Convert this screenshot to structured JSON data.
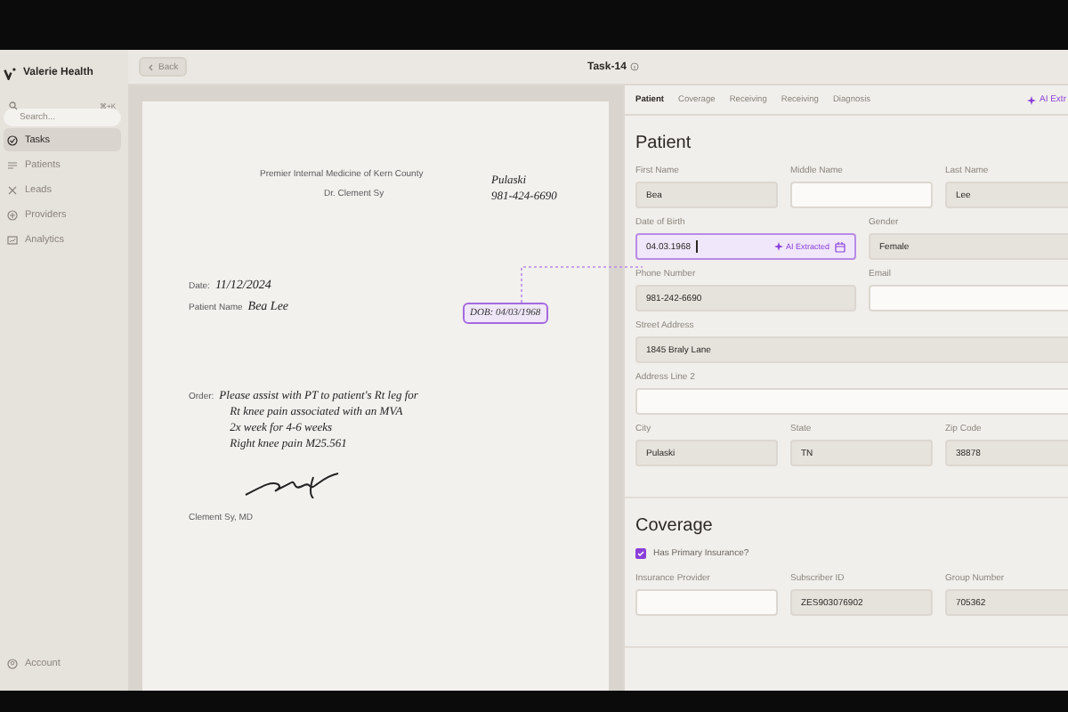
{
  "sidebar": {
    "brand": "Valerie Health",
    "search": {
      "placeholder": "Search...",
      "shortcut": "⌘+K"
    },
    "items": [
      {
        "label": "Tasks",
        "selected": true
      },
      {
        "label": "Patients",
        "selected": false
      },
      {
        "label": "Leads",
        "selected": false
      },
      {
        "label": "Providers",
        "selected": false
      },
      {
        "label": "Analytics",
        "selected": false
      }
    ],
    "account": "Account"
  },
  "header": {
    "back": "Back",
    "title": "Task-14"
  },
  "document": {
    "practice": "Premier Internal Medicine of Kern County",
    "doctor": "Dr. Clement Sy",
    "contact_lines": [
      "Pulaski",
      "981-424-6690"
    ],
    "date_label": "Date:",
    "date_value": "11/12/2024",
    "patient_label": "Patient Name",
    "patient_value": "Bea Lee",
    "dob_highlight": "DOB: 04/03/1968",
    "order_label": "Order:",
    "order_lines": [
      "Please assist with PT to patient's Rt leg for",
      "Rt knee pain associated with an MVA",
      "2x week for 4-6 weeks",
      "Right knee pain M25.561"
    ],
    "signer": "Clement Sy, MD"
  },
  "form": {
    "tabs": [
      {
        "label": "Patient",
        "selected": true
      },
      {
        "label": "Coverage",
        "selected": false
      },
      {
        "label": "Receiving",
        "selected": false
      },
      {
        "label": "Receiving",
        "selected": false
      },
      {
        "label": "Diagnosis",
        "selected": false
      }
    ],
    "ai_button": "AI Extr",
    "sections": [
      {
        "title": "Patient",
        "rows": [
          {
            "kind": "fields",
            "fields": [
              {
                "label": "First Name",
                "kind": "prefilled",
                "value": "Bea"
              },
              {
                "label": "Middle Name",
                "kind": "empty"
              },
              {
                "label": "Last Name",
                "kind": "prefilled",
                "value": "Lee"
              }
            ]
          },
          {
            "kind": "fields",
            "fields": [
              {
                "label": "Date of Birth",
                "kind": "ai_extracted",
                "value": "04.03.1968",
                "badge": "AI Extracted"
              },
              {
                "label": "Gender",
                "kind": "prefilled",
                "value": "Female"
              }
            ]
          },
          {
            "kind": "fields",
            "fields": [
              {
                "label": "Phone Number",
                "kind": "prefilled",
                "value": "981-242-6690"
              },
              {
                "label": "Email",
                "kind": "empty"
              }
            ]
          },
          {
            "kind": "fields",
            "fields": [
              {
                "label": "Street Address",
                "kind": "prefilled",
                "value": "1845 Braly Lane"
              }
            ]
          },
          {
            "kind": "fields",
            "fields": [
              {
                "label": "Address Line 2",
                "kind": "empty"
              }
            ]
          },
          {
            "kind": "fields",
            "fields": [
              {
                "label": "City",
                "kind": "prefilled",
                "value": "Pulaski"
              },
              {
                "label": "State",
                "kind": "prefilled",
                "value": "TN"
              },
              {
                "label": "Zip Code",
                "kind": "prefilled",
                "value": "38878"
              }
            ]
          }
        ]
      },
      {
        "title": "Coverage",
        "rows": [
          {
            "kind": "checkbox",
            "label": "Has Primary Insurance?",
            "checked": true
          },
          {
            "kind": "fields",
            "fields": [
              {
                "label": "Insurance Provider",
                "kind": "empty"
              },
              {
                "label": "Subscriber ID",
                "kind": "prefilled",
                "value": "ZES903076902"
              },
              {
                "label": "Group Number",
                "kind": "prefilled",
                "value": "705362"
              }
            ]
          }
        ]
      }
    ]
  }
}
